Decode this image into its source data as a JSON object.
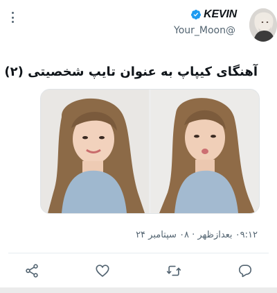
{
  "author": {
    "display_name": "KEVIN",
    "username": "Your_Moon@"
  },
  "tweet": {
    "text": "آهنگای کیپاپ به عنوان تایپ شخصیتی (۲)",
    "emoji": "cloud-rain-snow-icon",
    "timestamp": "۰۹:۱۲ بعدازظهر · ۰۸ سپتامبر ۲۴"
  },
  "media": {
    "photos": [
      {
        "icon": "photo-girl-smiling"
      },
      {
        "icon": "photo-girl-kissing"
      }
    ]
  },
  "actions": {
    "share": "share-icon",
    "like": "heart-icon",
    "retweet": "retweet-icon",
    "reply": "reply-icon"
  },
  "colors": {
    "verified": "#1d9bf0",
    "icon_gray": "#536471",
    "text": "#0f1419"
  }
}
